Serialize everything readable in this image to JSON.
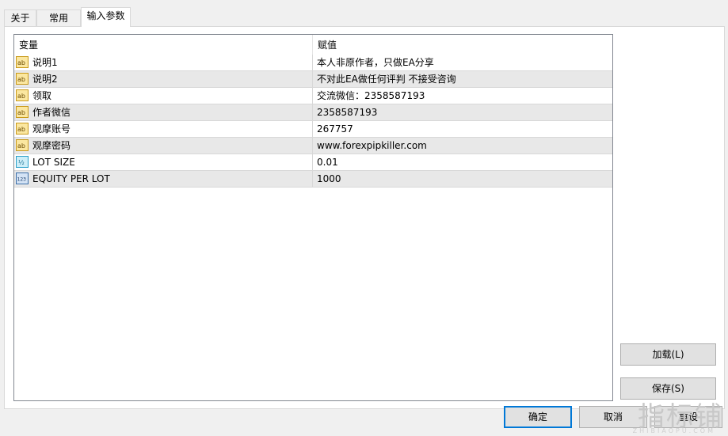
{
  "tabs": [
    "关于",
    "常用",
    "输入参数"
  ],
  "grid": {
    "col_variable": "变量",
    "col_value": "赋值",
    "rows": [
      {
        "name": "说明1",
        "value": "本人非原作者，只做EA分享",
        "type_icon": "string-ab-icon"
      },
      {
        "name": "说明2",
        "value": "不对此EA做任何评判 不接受咨询",
        "type_icon": "string-ab-icon"
      },
      {
        "name": "领取",
        "value": "交流微信：2358587193",
        "type_icon": "string-ab-icon"
      },
      {
        "name": "作者微信",
        "value": "2358587193",
        "type_icon": "string-ab-icon"
      },
      {
        "name": "观摩账号",
        "value": "267757",
        "type_icon": "string-ab-icon"
      },
      {
        "name": "观摩密码",
        "value": "www.forexpipkiller.com",
        "type_icon": "string-ab-icon"
      },
      {
        "name": "LOT SIZE",
        "value": "0.01",
        "type_icon": "double-icon"
      },
      {
        "name": "EQUITY PER LOT",
        "value": "1000",
        "type_icon": "integer-123-icon"
      }
    ]
  },
  "buttons": {
    "load": "加载(L)",
    "save": "保存(S)",
    "ok": "确定",
    "cancel": "取消",
    "reset": "重设"
  },
  "watermark": {
    "main": "指标铺",
    "sub": "ZHIBIAOPU.COM"
  }
}
